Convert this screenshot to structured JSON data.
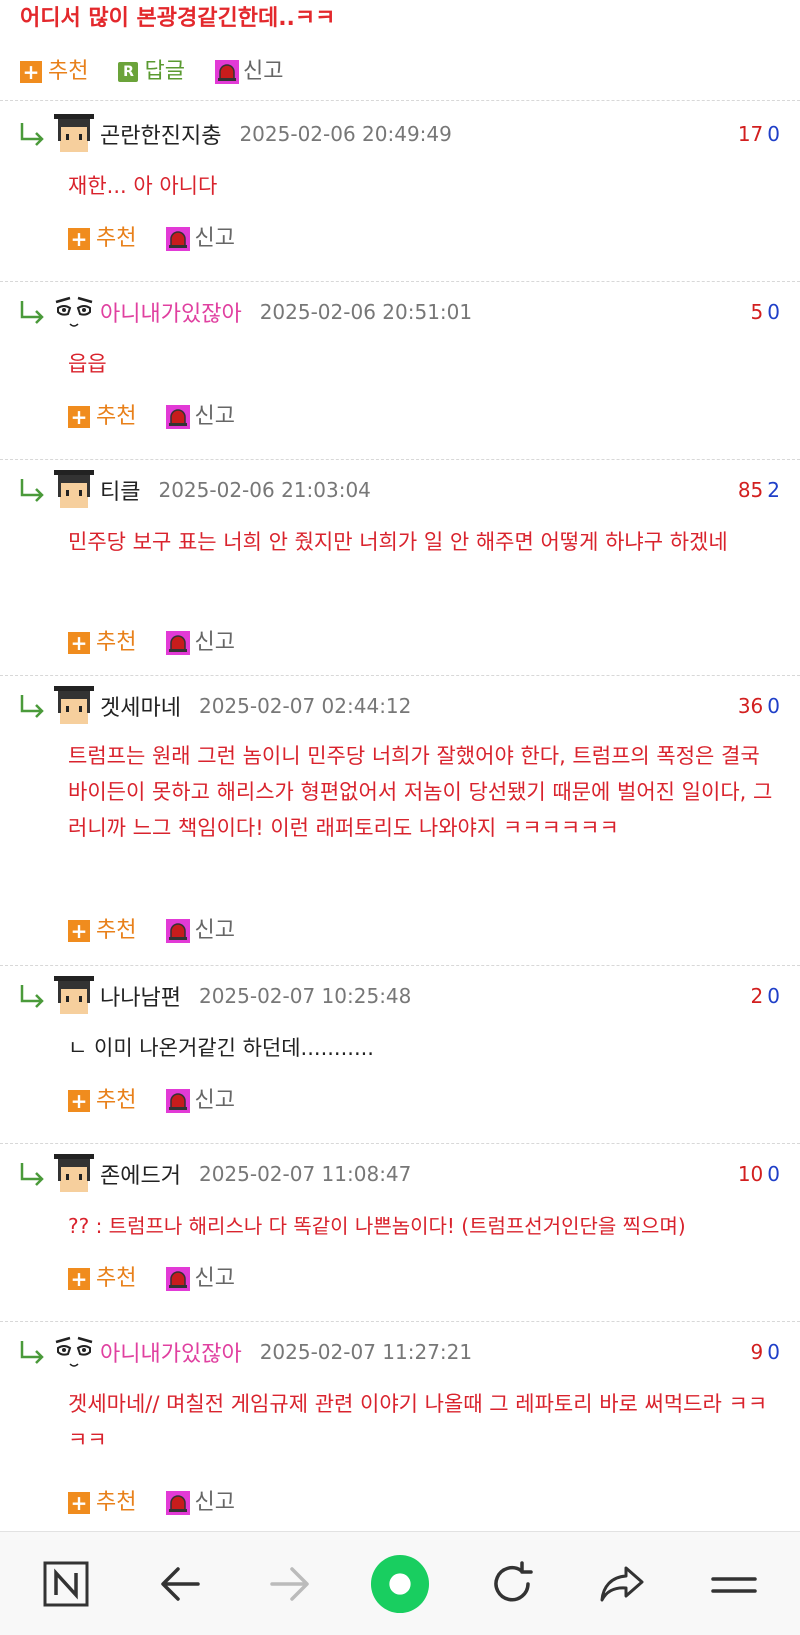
{
  "post": {
    "title": "어디서 많이 본광경같긴한데..ㅋㅋ",
    "recommend_label": "추천",
    "reply_label": "답글",
    "report_label": "신고"
  },
  "actions": {
    "recommend_label": "추천",
    "report_label": "신고"
  },
  "comments": [
    {
      "nick": "곤란한진지충",
      "avatar": "pixel-man-avatar-icon",
      "date": "2025-02-06 20:49:49",
      "up": "17",
      "down": "0",
      "text": "재한... 아 아니다"
    },
    {
      "nick": "아니내가있잖아",
      "avatar": "anime-face-avatar-icon",
      "date": "2025-02-06 20:51:01",
      "up": "5",
      "down": "0",
      "text": "읍읍"
    },
    {
      "nick": "티클",
      "avatar": "pixel-man-avatar-icon",
      "date": "2025-02-06 21:03:04",
      "up": "85",
      "down": "2",
      "text": "민주당 보구 표는 너희 안 줬지만 너희가 일 안 해주면 어떻게 하냐구 하겠네"
    },
    {
      "nick": "겟세마네",
      "avatar": "pixel-man-avatar-icon",
      "date": "2025-02-07 02:44:12",
      "up": "36",
      "down": "0",
      "text": "트럼프는 원래 그런 놈이니 민주당 너희가 잘했어야 한다, 트럼프의 폭정은 결국 바이든이 못하고 해리스가 형편없어서 저놈이 당선됐기 때문에 벌어진 일이다, 그러니까 느그 책임이다! 이런 래퍼토리도 나와야지 ㅋㅋㅋㅋㅋㅋ"
    },
    {
      "nick": "나나남편",
      "avatar": "pixel-man-avatar-icon",
      "date": "2025-02-07 10:25:48",
      "up": "2",
      "down": "0",
      "text": "ㄴ 이미 나온거같긴 하던데..........."
    },
    {
      "nick": "존에드거",
      "avatar": "pixel-man-avatar-icon",
      "date": "2025-02-07 11:08:47",
      "up": "10",
      "down": "0",
      "text": "?? : 트럼프나 해리스나 다 똑같이 나쁜놈이다! (트럼프선거인단을 찍으며)"
    },
    {
      "nick": "아니내가있잖아",
      "avatar": "anime-face-avatar-icon",
      "date": "2025-02-07 11:27:21",
      "up": "9",
      "down": "0",
      "text": "겟세마네// 며칠전 게임규제 관련 이야기 나올때 그 레파토리 바로 써먹드라 ㅋㅋㅋㅋ"
    }
  ],
  "colors": {
    "title_red": "#e3282c",
    "comment_red": "#d9232d",
    "upvote": "#d21f1f",
    "downvote": "#1f3fc8",
    "recommend_orange": "#e8801a",
    "reply_green": "#5a9a30",
    "pink_nick": "#e040a0",
    "naver_green": "#19ce60"
  },
  "bottom_nav": [
    "naver-n-icon",
    "back-arrow-icon",
    "forward-arrow-icon",
    "home-green-icon",
    "refresh-icon",
    "share-icon",
    "menu-icon"
  ]
}
